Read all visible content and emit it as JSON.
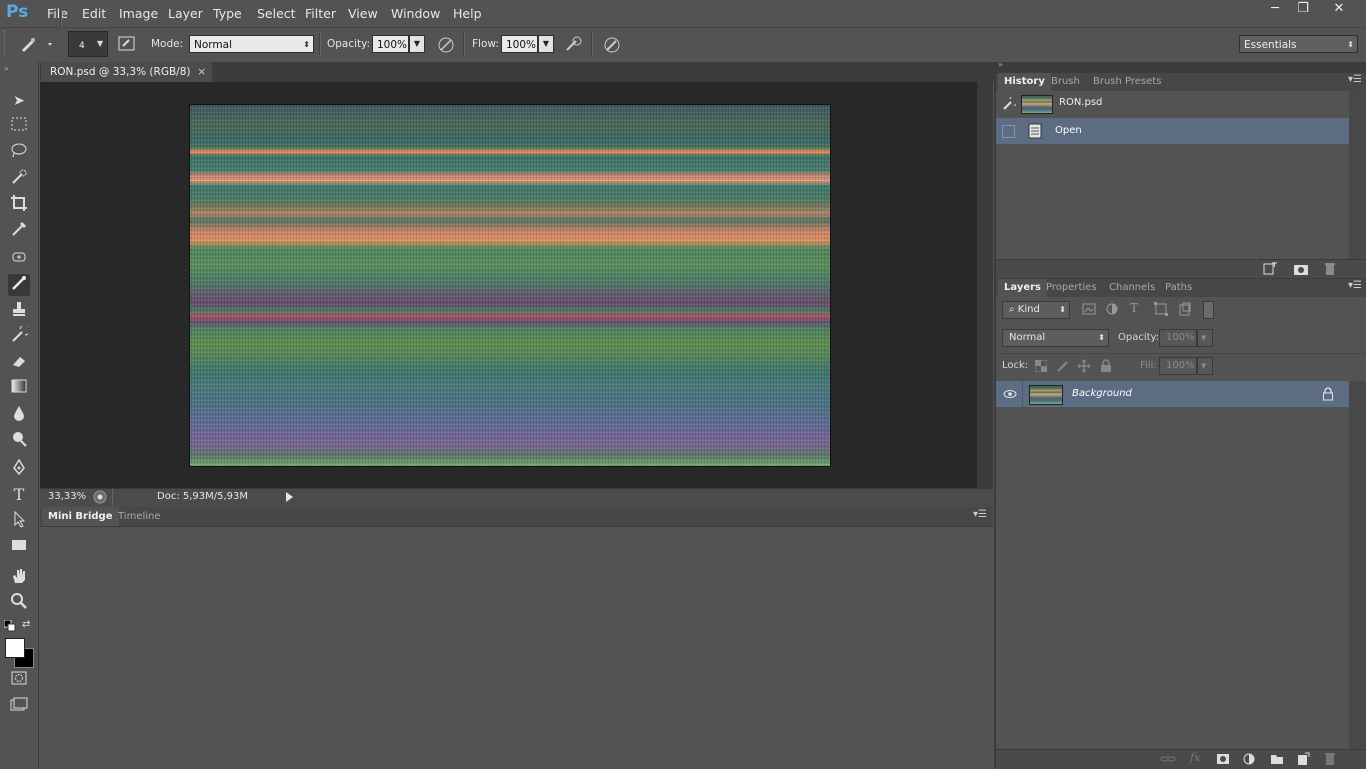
{
  "app": {
    "logo": "Ps"
  },
  "menu": [
    "File",
    "Edit",
    "Image",
    "Layer",
    "Type",
    "Select",
    "Filter",
    "View",
    "Window",
    "Help"
  ],
  "window_controls": {
    "minimize": "─",
    "restore": "❐",
    "close": "✕"
  },
  "options": {
    "brush_size": "4",
    "mode_label": "Mode:",
    "mode_value": "Normal",
    "opacity_label": "Opacity:",
    "opacity_value": "100%",
    "flow_label": "Flow:",
    "flow_value": "100%",
    "workspace": "Essentials"
  },
  "document": {
    "tab_title": "RON.psd @ 33,3% (RGB/8)",
    "close": "×",
    "zoom": "33,33%",
    "doc_size": "Doc: 5,93M/5,93M"
  },
  "bottom_panel": {
    "tabs": [
      "Mini Bridge",
      "Timeline"
    ]
  },
  "history": {
    "tabs": [
      "History",
      "Brush",
      "Brush Presets"
    ],
    "snapshot": "RON.psd",
    "states": [
      "Open"
    ]
  },
  "layers": {
    "tabs": [
      "Layers",
      "Properties",
      "Channels",
      "Paths"
    ],
    "filter_kind": "Kind",
    "blend_mode": "Normal",
    "opacity_label": "Opacity:",
    "opacity_value": "100%",
    "lock_label": "Lock:",
    "fill_label": "Fill:",
    "fill_value": "100%",
    "items": [
      {
        "name": "Background",
        "locked": true,
        "visible": true
      }
    ]
  },
  "colors": {
    "accent_selected": "#5b6c83",
    "panel_bg": "#535353",
    "logo_blue": "#59a9e6"
  }
}
